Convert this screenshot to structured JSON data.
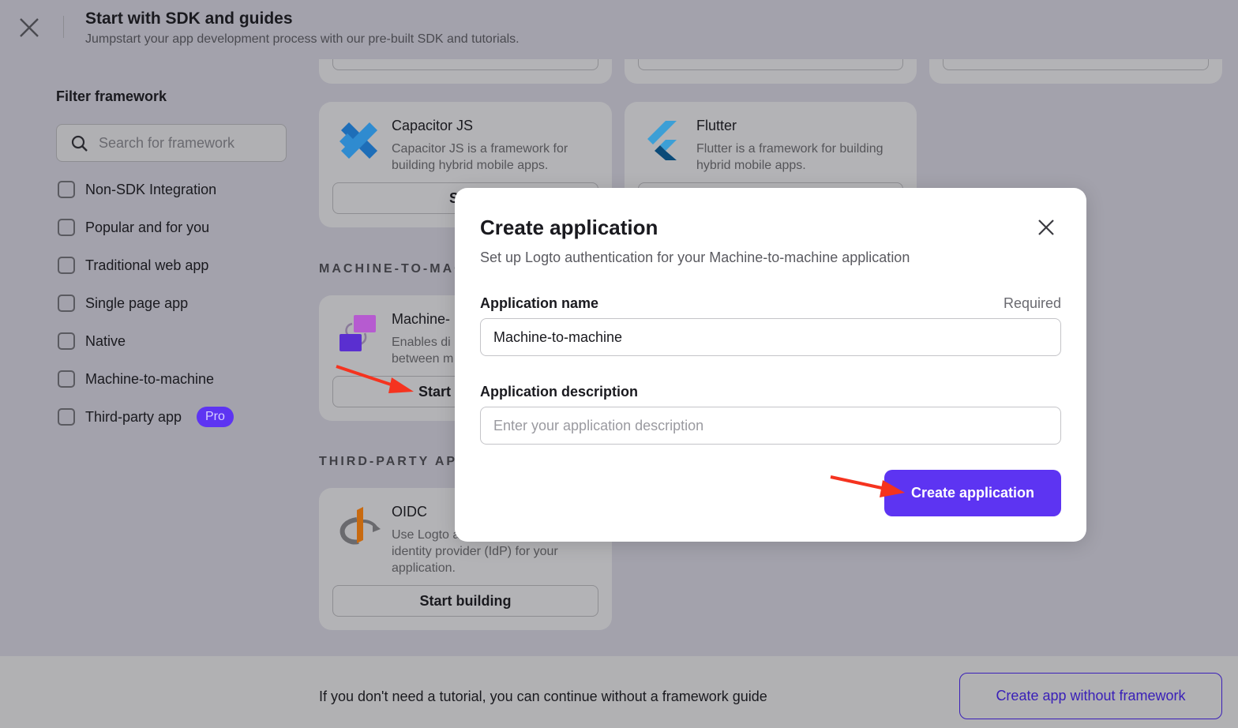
{
  "header": {
    "title": "Start with SDK and guides",
    "subtitle": "Jumpstart your app development process with our pre-built SDK and tutorials."
  },
  "filter": {
    "title": "Filter framework",
    "search_placeholder": "Search for framework",
    "options": [
      {
        "label": "Non-SDK Integration"
      },
      {
        "label": "Popular and for you"
      },
      {
        "label": "Traditional web app"
      },
      {
        "label": "Single page app"
      },
      {
        "label": "Native"
      },
      {
        "label": "Machine-to-machine"
      },
      {
        "label": "Third-party app",
        "badge": "Pro"
      }
    ]
  },
  "cards": {
    "capacitor": {
      "title": "Capacitor JS",
      "desc": "Capacitor JS is a framework for building hybrid mobile apps.",
      "button": "Start"
    },
    "flutter": {
      "title": "Flutter",
      "desc": "Flutter is a framework for building hybrid mobile apps."
    },
    "m2m_section": "MACHINE-TO-MAC",
    "m2m": {
      "title": "Machine-",
      "desc1": "Enables di",
      "desc2": "between m",
      "button": "Start"
    },
    "third_section": "THIRD-PARTY APP",
    "oidc": {
      "title": "OIDC",
      "desc1": "Use Logto a",
      "desc2": "identity provider (IdP) for your application.",
      "button": "Start building"
    }
  },
  "modal": {
    "title": "Create application",
    "subtitle": "Set up Logto authentication for your Machine-to-machine application",
    "name_label": "Application name",
    "required": "Required",
    "name_value": "Machine-to-machine",
    "desc_label": "Application description",
    "desc_placeholder": "Enter your application description",
    "submit": "Create application"
  },
  "footer": {
    "text": "If you don't need a tutorial, you can continue without a framework guide",
    "button": "Create app without framework"
  },
  "colors": {
    "primary": "#5d34f2",
    "badge": "#5d34f2",
    "annotation_arrow": "#f5331f"
  }
}
